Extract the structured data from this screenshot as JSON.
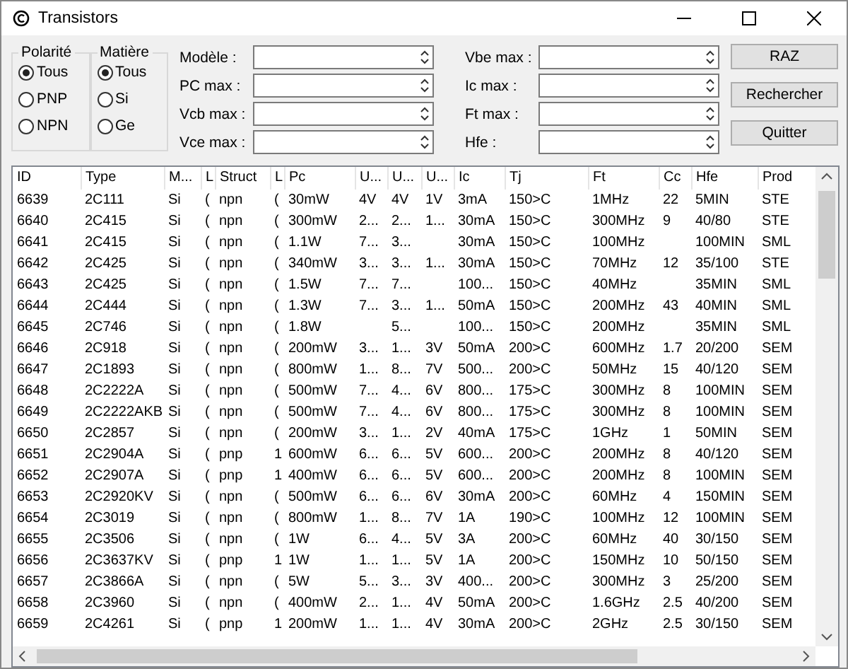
{
  "window": {
    "title": "Transistors"
  },
  "groups": [
    {
      "label": "Polarité",
      "options": [
        {
          "label": "Tous",
          "selected": true
        },
        {
          "label": "PNP",
          "selected": false
        },
        {
          "label": "NPN",
          "selected": false
        }
      ]
    },
    {
      "label": "Matière",
      "options": [
        {
          "label": "Tous",
          "selected": true
        },
        {
          "label": "Si",
          "selected": false
        },
        {
          "label": "Ge",
          "selected": false
        }
      ]
    }
  ],
  "fields_left": [
    {
      "label": "Modèle :"
    },
    {
      "label": "PC max :"
    },
    {
      "label": "Vcb max :"
    },
    {
      "label": "Vce max :"
    }
  ],
  "fields_right": [
    {
      "label": "Vbe max :"
    },
    {
      "label": "Ic max :"
    },
    {
      "label": "Ft max :"
    },
    {
      "label": "Hfe :"
    }
  ],
  "buttons": [
    "RAZ",
    "Rechercher",
    "Quitter"
  ],
  "table": {
    "columns": [
      "ID",
      "Type",
      "M...",
      "L",
      "Struct",
      "L",
      "Pc",
      "U...",
      "U...",
      "U...",
      "Ic",
      "Tj",
      "Ft",
      "Cc",
      "Hfe",
      "Prod"
    ],
    "rows": [
      [
        "6639",
        "2C111",
        "Si",
        "(",
        "npn",
        "(",
        "30mW",
        "4V",
        "4V",
        "1V",
        "3mA",
        "150>C",
        "1MHz",
        "22",
        "5MIN",
        "STE"
      ],
      [
        "6640",
        "2C415",
        "Si",
        "(",
        "npn",
        "(",
        "300mW",
        "2...",
        "2...",
        "1...",
        "30mA",
        "150>C",
        "300MHz",
        "9",
        "40/80",
        "STE"
      ],
      [
        "6641",
        "2C415",
        "Si",
        "(",
        "npn",
        "(",
        "1.1W",
        "7...",
        "3...",
        "",
        "30mA",
        "150>C",
        "100MHz",
        "",
        "100MIN",
        "SML"
      ],
      [
        "6642",
        "2C425",
        "Si",
        "(",
        "npn",
        "(",
        "340mW",
        "3...",
        "3...",
        "1...",
        "30mA",
        "150>C",
        "70MHz",
        "12",
        "35/100",
        "STE"
      ],
      [
        "6643",
        "2C425",
        "Si",
        "(",
        "npn",
        "(",
        "1.5W",
        "7...",
        "7...",
        "",
        "100...",
        "150>C",
        "40MHz",
        "",
        "35MIN",
        "SML"
      ],
      [
        "6644",
        "2C444",
        "Si",
        "(",
        "npn",
        "(",
        "1.3W",
        "7...",
        "3...",
        "1...",
        "50mA",
        "150>C",
        "200MHz",
        "43",
        "40MIN",
        "SML"
      ],
      [
        "6645",
        "2C746",
        "Si",
        "(",
        "npn",
        "(",
        "1.8W",
        "",
        "5...",
        "",
        "100...",
        "150>C",
        "200MHz",
        "",
        "35MIN",
        "SML"
      ],
      [
        "6646",
        "2C918",
        "Si",
        "(",
        "npn",
        "(",
        "200mW",
        "3...",
        "1...",
        "3V",
        "50mA",
        "200>C",
        "600MHz",
        "1.7",
        "20/200",
        "SEM"
      ],
      [
        "6647",
        "2C1893",
        "Si",
        "(",
        "npn",
        "(",
        "800mW",
        "1...",
        "8...",
        "7V",
        "500...",
        "200>C",
        "50MHz",
        "15",
        "40/120",
        "SEM"
      ],
      [
        "6648",
        "2C2222A",
        "Si",
        "(",
        "npn",
        "(",
        "500mW",
        "7...",
        "4...",
        "6V",
        "800...",
        "175>C",
        "300MHz",
        "8",
        "100MIN",
        "SEM"
      ],
      [
        "6649",
        "2C2222AKB",
        "Si",
        "(",
        "npn",
        "(",
        "500mW",
        "7...",
        "4...",
        "6V",
        "800...",
        "175>C",
        "300MHz",
        "8",
        "100MIN",
        "SEM"
      ],
      [
        "6650",
        "2C2857",
        "Si",
        "(",
        "npn",
        "(",
        "200mW",
        "3...",
        "1...",
        "2V",
        "40mA",
        "175>C",
        "1GHz",
        "1",
        "50MIN",
        "SEM"
      ],
      [
        "6651",
        "2C2904A",
        "Si",
        "(",
        "pnp",
        "1",
        "600mW",
        "6...",
        "6...",
        "5V",
        "600...",
        "200>C",
        "200MHz",
        "8",
        "40/120",
        "SEM"
      ],
      [
        "6652",
        "2C2907A",
        "Si",
        "(",
        "pnp",
        "1",
        "400mW",
        "6...",
        "6...",
        "5V",
        "600...",
        "200>C",
        "200MHz",
        "8",
        "100MIN",
        "SEM"
      ],
      [
        "6653",
        "2C2920KV",
        "Si",
        "(",
        "npn",
        "(",
        "500mW",
        "6...",
        "6...",
        "6V",
        "30mA",
        "200>C",
        "60MHz",
        "4",
        "150MIN",
        "SEM"
      ],
      [
        "6654",
        "2C3019",
        "Si",
        "(",
        "npn",
        "(",
        "800mW",
        "1...",
        "8...",
        "7V",
        "1A",
        "190>C",
        "100MHz",
        "12",
        "100MIN",
        "SEM"
      ],
      [
        "6655",
        "2C3506",
        "Si",
        "(",
        "npn",
        "(",
        "1W",
        "6...",
        "4...",
        "5V",
        "3A",
        "200>C",
        "60MHz",
        "40",
        "30/150",
        "SEM"
      ],
      [
        "6656",
        "2C3637KV",
        "Si",
        "(",
        "pnp",
        "1",
        "1W",
        "1...",
        "1...",
        "5V",
        "1A",
        "200>C",
        "150MHz",
        "10",
        "50/150",
        "SEM"
      ],
      [
        "6657",
        "2C3866A",
        "Si",
        "(",
        "npn",
        "(",
        "5W",
        "5...",
        "3...",
        "3V",
        "400...",
        "200>C",
        "300MHz",
        "3",
        "25/200",
        "SEM"
      ],
      [
        "6658",
        "2C3960",
        "Si",
        "(",
        "npn",
        "(",
        "400mW",
        "2...",
        "1...",
        "4V",
        "50mA",
        "200>C",
        "1.6GHz",
        "2.5",
        "40/200",
        "SEM"
      ],
      [
        "6659",
        "2C4261",
        "Si",
        "(",
        "pnp",
        "1",
        "200mW",
        "1...",
        "1...",
        "4V",
        "30mA",
        "200>C",
        "2GHz",
        "2.5",
        "30/150",
        "SEM"
      ]
    ]
  }
}
